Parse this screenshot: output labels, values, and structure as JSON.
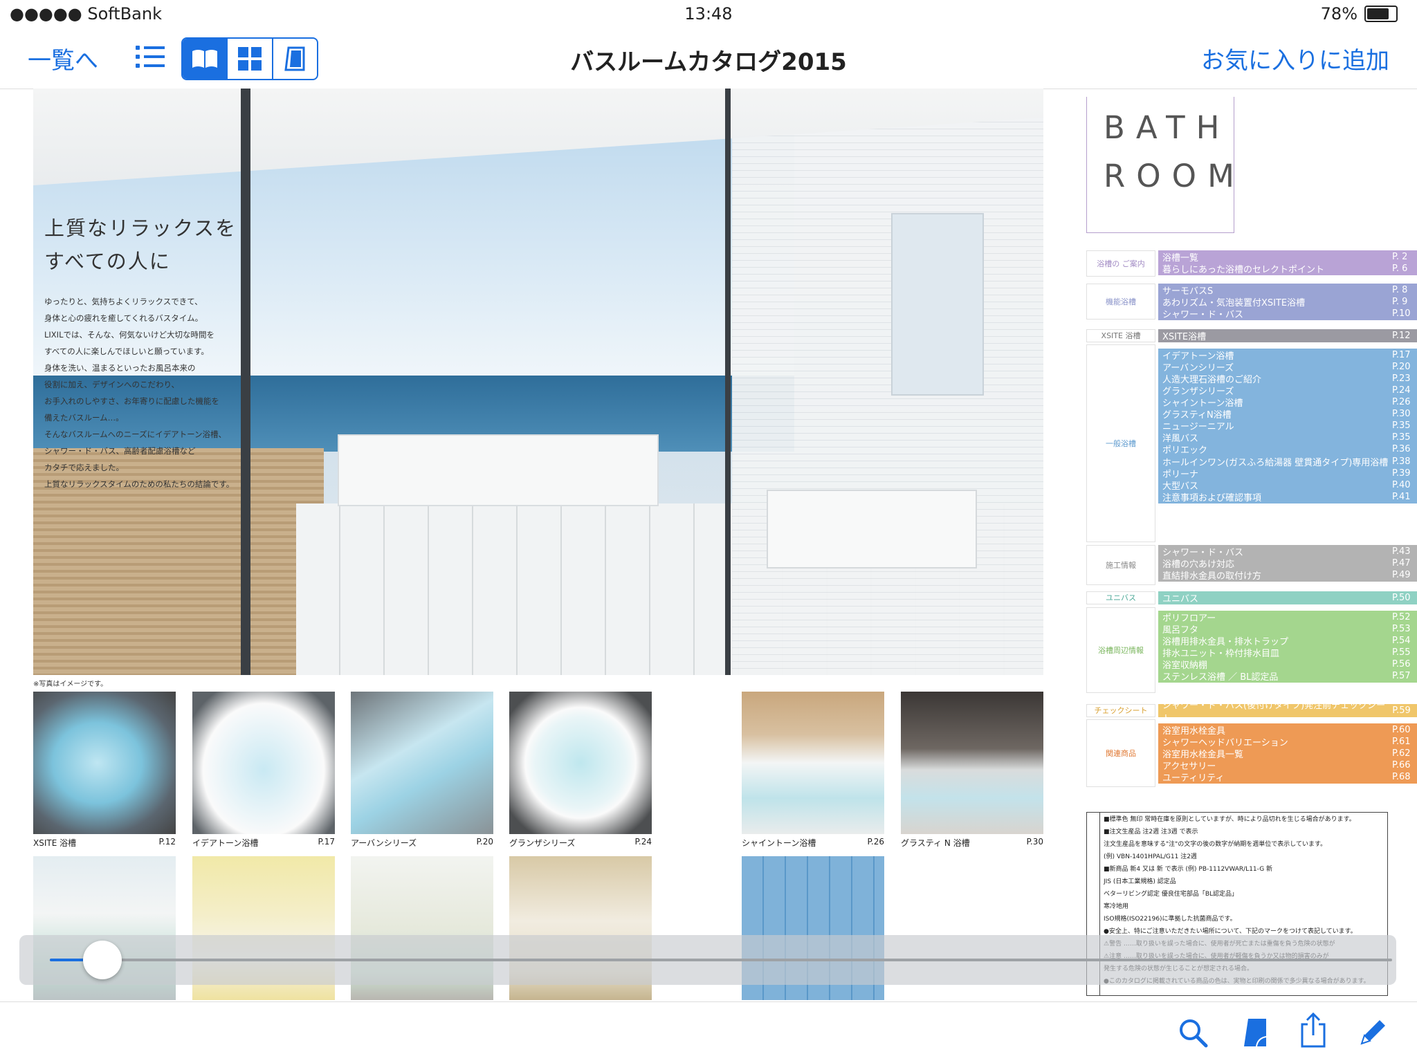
{
  "status_bar": {
    "carrier": "●●●●● SoftBank",
    "time": "13:48",
    "battery": "78%",
    "battery_level": 0.78
  },
  "nav": {
    "back_label": "一覧へ",
    "title": "バスルームカタログ2015",
    "favorite_label": "お気に入りに追加",
    "accent_color": "#1a6fe0"
  },
  "hero": {
    "headline_line1": "上質なリラックスを",
    "headline_line2": "すべての人に",
    "body": [
      "ゆったりと、気持ちよくリラックスできて、",
      "身体と心の疲れを癒してくれるバスタイム。",
      "LIXILでは、そんな、何気ないけど大切な時間を",
      "すべての人に楽しんでほしいと願っています。",
      "身体を洗い、温まるといったお風呂本来の",
      "役割に加え、デザインへのこだわり、",
      "お手入れのしやすさ、お年寄りに配慮した機能を",
      "備えたバスルーム…。",
      "そんなバスルームへのニーズにイデアトーン浴槽、",
      "シャワー・ド・バス、高齢者配慮浴槽など",
      "カタチで応えました。",
      "上質なリラックスタイムのための私たちの結論です。"
    ],
    "note": "※写真はイメージです。"
  },
  "thumbnails": [
    {
      "label": "XSITE 浴槽",
      "page": "P.12"
    },
    {
      "label": "イデアトーン浴槽",
      "page": "P.17"
    },
    {
      "label": "アーバンシリーズ",
      "page": "P.20"
    },
    {
      "label": "グランザシリーズ",
      "page": "P.24"
    },
    {
      "label": "シャイントーン浴槽",
      "page": "P.26"
    },
    {
      "label": "グラスティ N 浴槽",
      "page": "P.30"
    }
  ],
  "slider": {
    "position": 0.03
  },
  "toc": {
    "brand_line1": "BATH",
    "brand_line2": "ROOM",
    "categories": [
      "浴槽の\nご案内",
      "機能浴槽",
      "XSITE 浴槽",
      "一般浴槽",
      "施工情報",
      "ユニバス",
      "浴槽周辺情報",
      "チェックシート",
      "関連商品"
    ],
    "rows": [
      {
        "label": "浴槽一覧",
        "page": "P. 2",
        "color": "#b9a3d6"
      },
      {
        "label": "暮らしにあった浴槽のセレクトポイント",
        "page": "P. 6",
        "color": "#b9a3d6"
      },
      {
        "label": "サーモバスS",
        "page": "P. 8",
        "color": "#9aa4d4"
      },
      {
        "label": "あわリズム・気泡装置付XSITE浴槽",
        "page": "P. 9",
        "color": "#9aa4d4"
      },
      {
        "label": "シャワー・ド・バス",
        "page": "P.10",
        "color": "#9aa4d4"
      },
      {
        "label": "XSITE浴槽",
        "page": "P.12",
        "color": "#9b9aa2"
      },
      {
        "label": "イデアトーン浴槽",
        "page": "P.17",
        "color": "#83b4dd"
      },
      {
        "label": "アーバンシリーズ",
        "page": "P.20",
        "color": "#83b4dd"
      },
      {
        "label": "人造大理石浴槽のご紹介",
        "page": "P.23",
        "color": "#83b4dd"
      },
      {
        "label": "グランザシリーズ",
        "page": "P.24",
        "color": "#83b4dd"
      },
      {
        "label": "シャイントーン浴槽",
        "page": "P.26",
        "color": "#83b4dd"
      },
      {
        "label": "グラスティN浴槽",
        "page": "P.30",
        "color": "#83b4dd"
      },
      {
        "label": "ニュージーニアル",
        "page": "P.35",
        "color": "#83b4dd"
      },
      {
        "label": "洋風バス",
        "page": "P.35",
        "color": "#83b4dd"
      },
      {
        "label": "ポリエック",
        "page": "P.36",
        "color": "#83b4dd"
      },
      {
        "label": "ホールインワン(ガスふろ給湯器 壁貫通タイプ)専用浴槽",
        "page": "P.38",
        "color": "#83b4dd"
      },
      {
        "label": "ポリーナ",
        "page": "P.39",
        "color": "#83b4dd"
      },
      {
        "label": "大型バス",
        "page": "P.40",
        "color": "#83b4dd"
      },
      {
        "label": "注意事項および確認事項",
        "page": "P.41",
        "color": "#83b4dd"
      },
      {
        "label": "シャワー・ド・バス",
        "page": "P.43",
        "color": "#b3b3b3"
      },
      {
        "label": "浴槽の穴あけ対応",
        "page": "P.47",
        "color": "#b3b3b3"
      },
      {
        "label": "直結排水金具の取付け方",
        "page": "P.49",
        "color": "#b3b3b3"
      },
      {
        "label": "ユニバス",
        "page": "P.50",
        "color": "#8fd1c3"
      },
      {
        "label": "ポリフロアー",
        "page": "P.52",
        "color": "#a4d68e"
      },
      {
        "label": "風呂フタ",
        "page": "P.53",
        "color": "#a4d68e"
      },
      {
        "label": "浴槽用排水金具・排水トラップ",
        "page": "P.54",
        "color": "#a4d68e"
      },
      {
        "label": "排水ユニット・枠付排水目皿",
        "page": "P.55",
        "color": "#a4d68e"
      },
      {
        "label": "浴室収納棚",
        "page": "P.56",
        "color": "#a4d68e"
      },
      {
        "label": "ステンレス浴槽 ／ BL認定品",
        "page": "P.57",
        "color": "#a4d68e"
      },
      {
        "label": "シャワー・ド・バス(後付けタイプ)発注前チェックシート",
        "page": "P.59",
        "color": "#f0c66a"
      },
      {
        "label": "浴室用水栓金具",
        "page": "P.60",
        "color": "#ee9a55"
      },
      {
        "label": "シャワーヘッドバリエーション",
        "page": "P.61",
        "color": "#ee9a55"
      },
      {
        "label": "浴室用水栓金具一覧",
        "page": "P.62",
        "color": "#ee9a55"
      },
      {
        "label": "アクセサリー",
        "page": "P.66",
        "color": "#ee9a55"
      },
      {
        "label": "ユーティリティ",
        "page": "P.68",
        "color": "#ee9a55"
      }
    ],
    "legal_lines": [
      "■標準色 無印 常時在庫を原則としていますが、時により品切れを生じる場合があります。",
      "■注文生産品 注2週 注3週 で表示",
      "注文生産品を意味する\"注\"の文字の後の数字が納期を週単位で表示しています。",
      "(例) VBN-1401HPAL/G11 注2週",
      "■新商品 新4 又は 新 で表示 (例) PB-1112VWAR/L11-G 新",
      "JIS (日本工業規格) 認定品",
      "ベターリビング認定 優良住宅部品「BL認定品」",
      "寒冷地用",
      "ISO規格(ISO22196)に準拠した抗菌商品です。",
      "●安全上、特にご注意いただきたい場所について、下記のマークをつけて表記しています。",
      "⚠警告 ……取り扱いを誤った場合に、使用者が死亡または重傷を負う危険の状態が",
      "⚠注意 ……取り扱いを誤った場合に、使用者が軽傷を負うか又は物的損害のみが",
      "発生する危険の状態が生じることが想定される場合。",
      "●このカタログに掲載されている商品の色は、実物と印刷の関係で多少異なる場合があります。"
    ]
  }
}
